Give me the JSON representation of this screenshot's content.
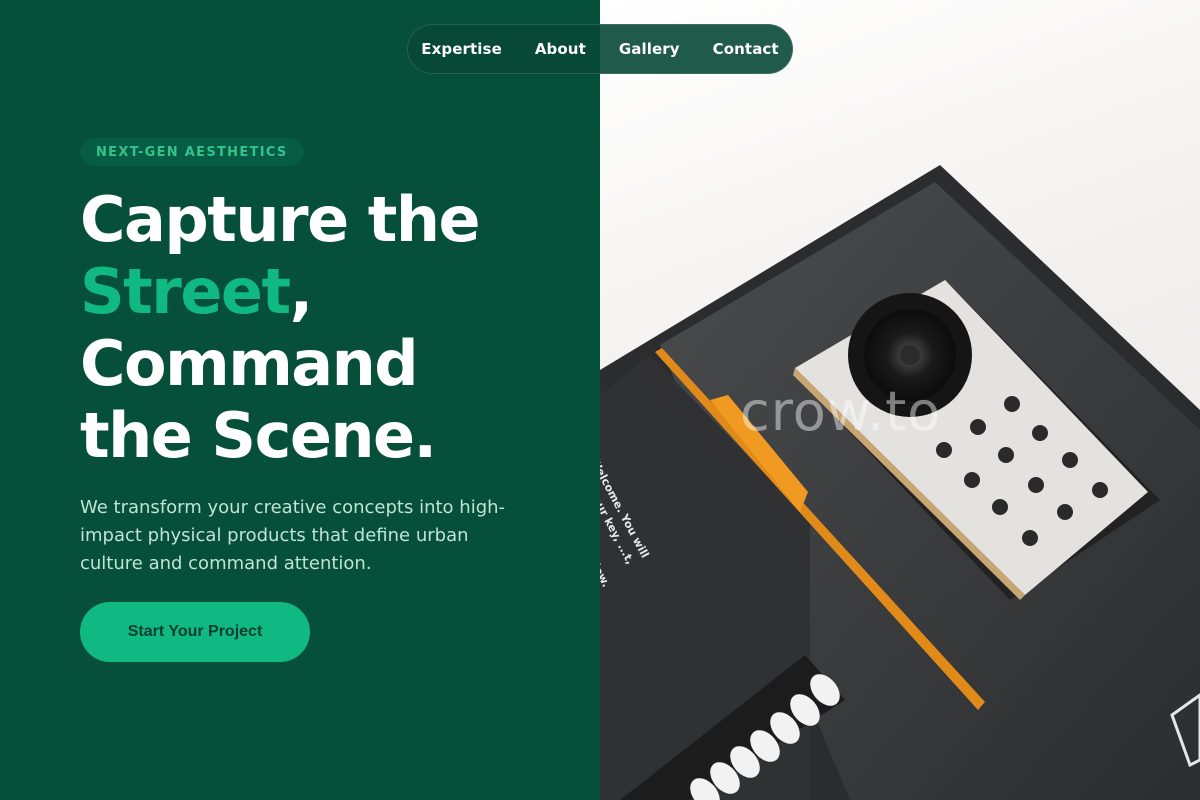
{
  "nav": {
    "items": [
      {
        "label": "Expertise"
      },
      {
        "label": "About"
      },
      {
        "label": "Gallery"
      },
      {
        "label": "Contact"
      }
    ]
  },
  "hero": {
    "badge": "NEXT-GEN AESTHETICS",
    "headline": {
      "line1": "Capture the",
      "accent": "Street",
      "accent_suffix": ",",
      "line3": "Command",
      "line4": "the Scene."
    },
    "subtext": "We transform your creative concepts into high-impact physical products that define urban culture and command attention.",
    "cta_label": "Start Your Project"
  },
  "image": {
    "watermark": "crow.to",
    "box_text": "Welcome. You will find your key, ...t, cable, and ...structions below. ...ab to begin."
  },
  "colors": {
    "primary_dark": "#064f3b",
    "accent": "#10b981",
    "text_light": "#ffffff",
    "subtext": "#bfe3d4"
  }
}
